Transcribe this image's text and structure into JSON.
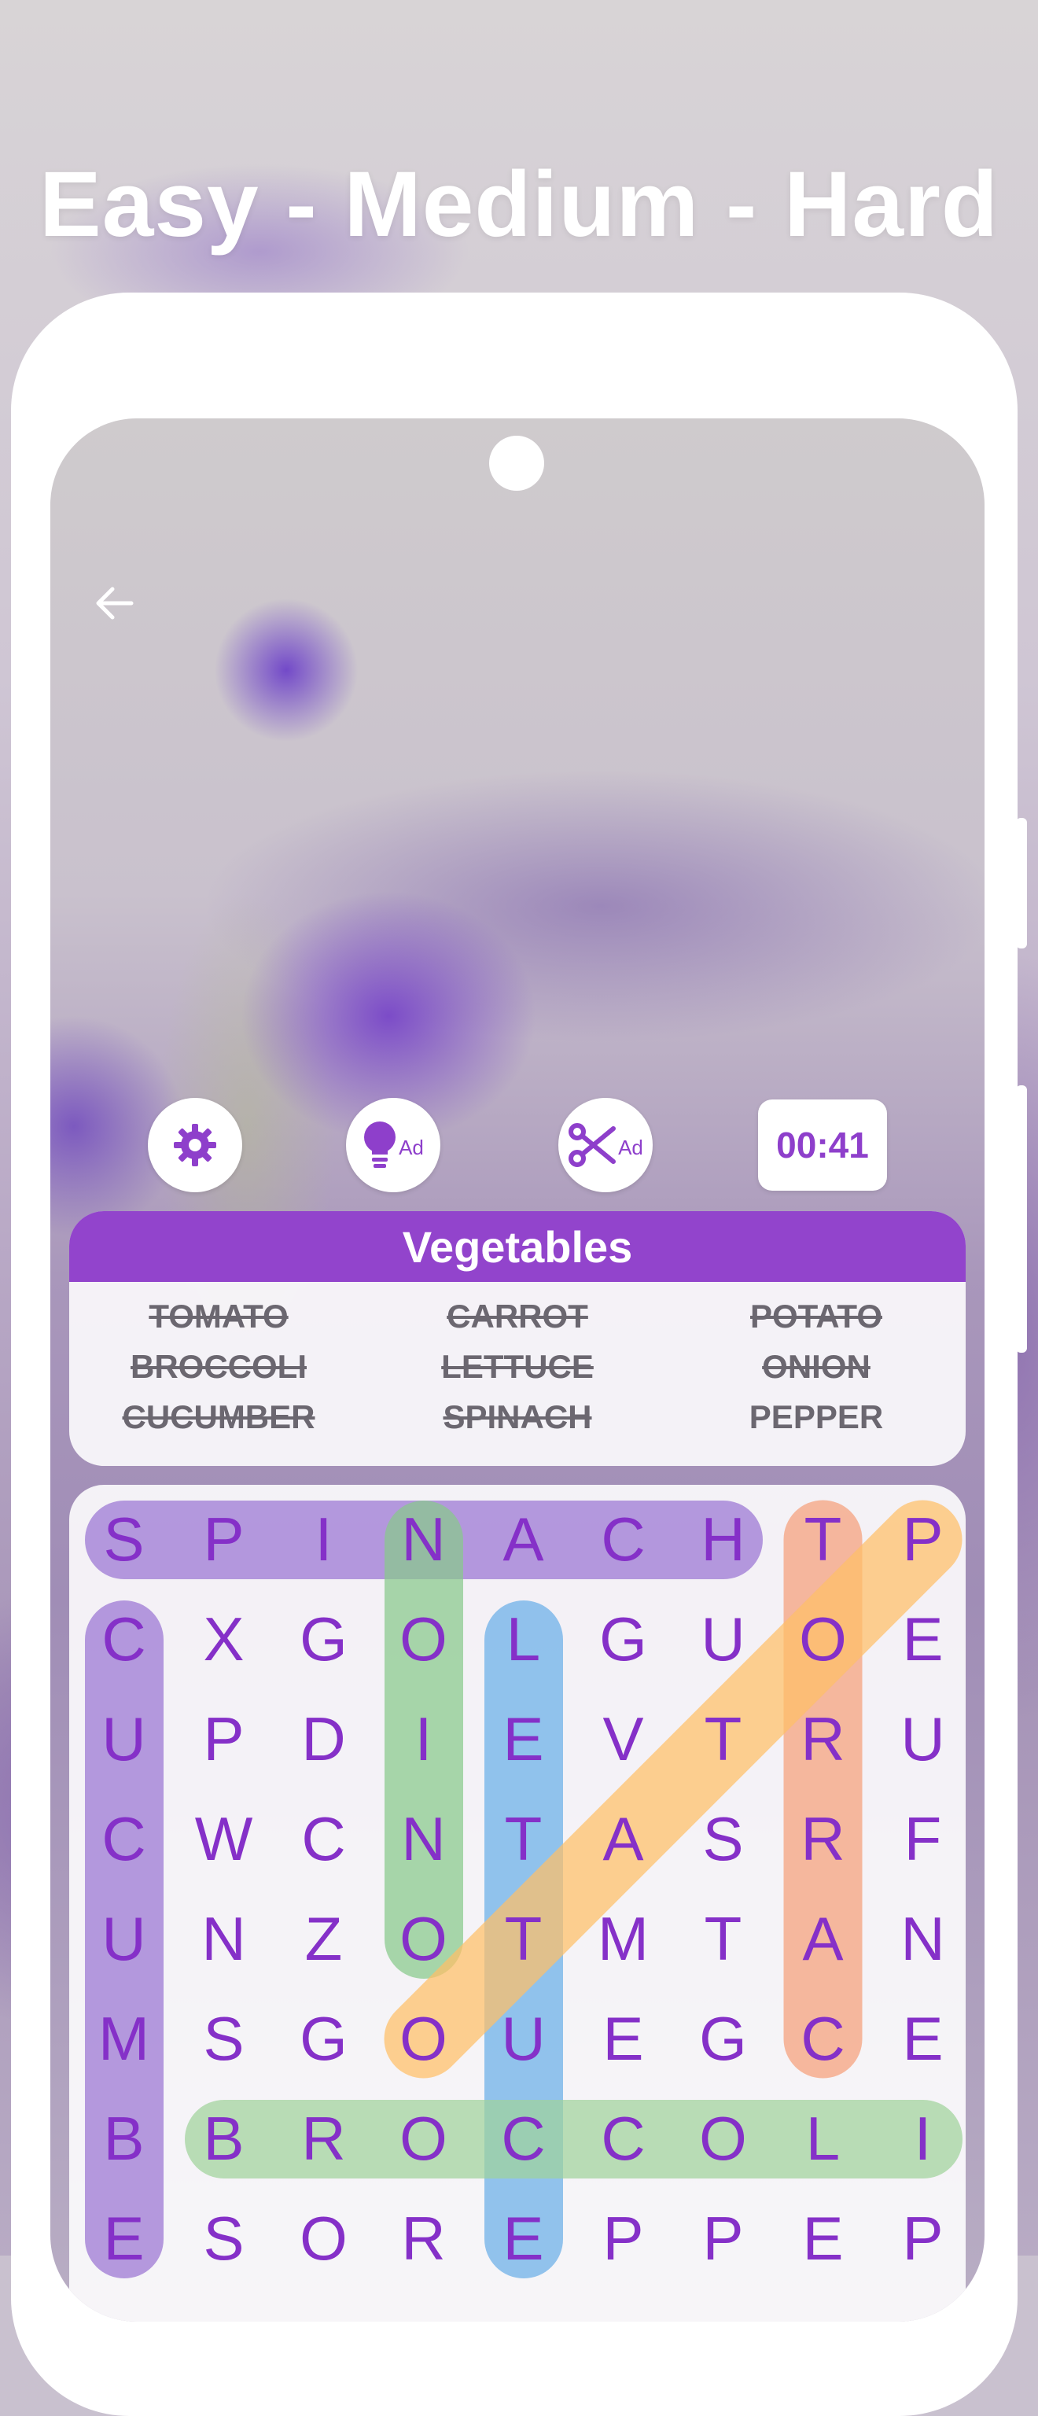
{
  "promo": {
    "title": "Easy - Medium - Hard"
  },
  "toolbar": {
    "settings_icon": "gear-icon",
    "hint_icon": "lightbulb-icon",
    "hint_ad": "Ad",
    "cut_icon": "scissors-icon",
    "cut_ad": "Ad",
    "timer": "00:41"
  },
  "colors": {
    "accent": "#9244cc",
    "letter": "#8530c8"
  },
  "category": {
    "title": "Vegetables"
  },
  "words": [
    {
      "text": "TOMATO",
      "found": true
    },
    {
      "text": "CARROT",
      "found": true
    },
    {
      "text": "POTATO",
      "found": true
    },
    {
      "text": "BROCCOLI",
      "found": true
    },
    {
      "text": "LETTUCE",
      "found": true
    },
    {
      "text": "ONION",
      "found": true
    },
    {
      "text": "CUCUMBER",
      "found": true
    },
    {
      "text": "SPINACH",
      "found": true
    },
    {
      "text": "PEPPER",
      "found": false
    }
  ],
  "grid": [
    [
      "S",
      "P",
      "I",
      "N",
      "A",
      "C",
      "H",
      "T",
      "P"
    ],
    [
      "C",
      "X",
      "G",
      "O",
      "L",
      "G",
      "U",
      "O",
      "E"
    ],
    [
      "U",
      "P",
      "D",
      "I",
      "E",
      "V",
      "T",
      "R",
      "U"
    ],
    [
      "C",
      "W",
      "C",
      "N",
      "T",
      "A",
      "S",
      "R",
      "F"
    ],
    [
      "U",
      "N",
      "Z",
      "O",
      "T",
      "M",
      "T",
      "A",
      "N"
    ],
    [
      "M",
      "S",
      "G",
      "O",
      "U",
      "E",
      "G",
      "C",
      "E"
    ],
    [
      "B",
      "B",
      "R",
      "O",
      "C",
      "C",
      "O",
      "L",
      "I"
    ],
    [
      "E",
      "S",
      "O",
      "R",
      "E",
      "P",
      "P",
      "E",
      "P"
    ]
  ],
  "found_highlights": [
    {
      "word": "SPINACH",
      "color": "#9a74d2",
      "from": [
        0,
        0
      ],
      "to": [
        0,
        6
      ]
    },
    {
      "word": "CUCUMBER",
      "color": "#9a74d2",
      "from": [
        1,
        0
      ],
      "to": [
        7,
        0
      ]
    },
    {
      "word": "ONION",
      "color": "#88c98a",
      "from": [
        0,
        3
      ],
      "to": [
        4,
        3
      ]
    },
    {
      "word": "LETTUCE",
      "color": "#6aaee8",
      "from": [
        1,
        4
      ],
      "to": [
        7,
        4
      ]
    },
    {
      "word": "CARROT",
      "color": "#f5a07a",
      "from": [
        0,
        7
      ],
      "to": [
        5,
        7
      ]
    },
    {
      "word": "BROCCOLI",
      "color": "#9fd39b",
      "from": [
        6,
        1
      ],
      "to": [
        6,
        8
      ]
    },
    {
      "word": "POTATO",
      "color": "#ffbf66",
      "from": [
        0,
        8
      ],
      "to": [
        5,
        3
      ]
    }
  ]
}
